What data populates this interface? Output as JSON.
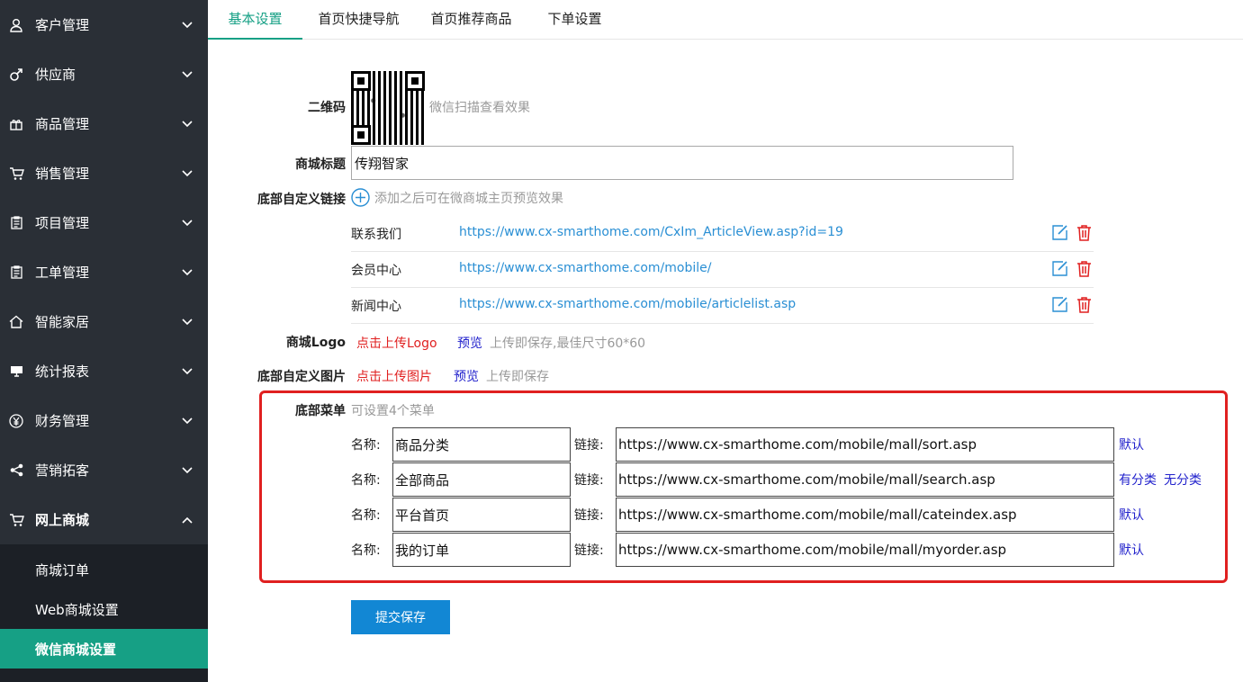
{
  "sidebar": {
    "items": [
      {
        "label": "客户管理",
        "icon": "user-icon"
      },
      {
        "label": "供应商",
        "icon": "male-icon"
      },
      {
        "label": "商品管理",
        "icon": "gift-icon"
      },
      {
        "label": "销售管理",
        "icon": "cart-icon"
      },
      {
        "label": "项目管理",
        "icon": "clipboard-icon"
      },
      {
        "label": "工单管理",
        "icon": "clipboard-icon"
      },
      {
        "label": "智能家居",
        "icon": "home-icon"
      },
      {
        "label": "统计报表",
        "icon": "monitor-icon"
      },
      {
        "label": "财务管理",
        "icon": "yen-icon"
      },
      {
        "label": "营销拓客",
        "icon": "share-icon"
      },
      {
        "label": "网上商城",
        "icon": "cart-icon"
      }
    ],
    "sub_items": [
      {
        "label": "商城订单"
      },
      {
        "label": "Web商城设置"
      },
      {
        "label": "微信商城设置"
      }
    ]
  },
  "tabs": [
    {
      "label": "基本设置"
    },
    {
      "label": "首页快捷导航"
    },
    {
      "label": "首页推荐商品"
    },
    {
      "label": "下单设置"
    }
  ],
  "form": {
    "qr_label": "二维码",
    "qr_hint": "微信扫描查看效果",
    "title_label": "商城标题",
    "title_value": "传翔智家",
    "footer_links_label": "底部自定义链接",
    "footer_links_hint": "添加之后可在微商城主页预览效果",
    "footer_links": [
      {
        "name": "联系我们",
        "url": "https://www.cx-smarthome.com/CxIm_ArticleView.asp?id=19"
      },
      {
        "name": "会员中心",
        "url": "https://www.cx-smarthome.com/mobile/"
      },
      {
        "name": "新闻中心",
        "url": "https://www.cx-smarthome.com/mobile/articlelist.asp"
      }
    ],
    "logo_label": "商城Logo",
    "logo_upload": "点击上传Logo",
    "logo_preview": "预览",
    "logo_hint": "上传即保存,最佳尺寸60*60",
    "image_label": "底部自定义图片",
    "image_upload": "点击上传图片",
    "image_preview": "预览",
    "image_hint": "上传即保存",
    "menu_label": "底部菜单",
    "menu_hint": "可设置4个菜单",
    "menu_name_label": "名称:",
    "menu_link_label": "链接:",
    "menus": [
      {
        "name": "商品分类",
        "url": "https://www.cx-smarthome.com/mobile/mall/sort.asp",
        "action1": "默认",
        "action2": ""
      },
      {
        "name": "全部商品",
        "url": "https://www.cx-smarthome.com/mobile/mall/search.asp",
        "action1": "有分类",
        "action2": "无分类"
      },
      {
        "name": "平台首页",
        "url": "https://www.cx-smarthome.com/mobile/mall/cateindex.asp",
        "action1": "默认",
        "action2": ""
      },
      {
        "name": "我的订单",
        "url": "https://www.cx-smarthome.com/mobile/mall/myorder.asp",
        "action1": "默认",
        "action2": ""
      }
    ],
    "submit_label": "提交保存"
  },
  "colors": {
    "sidebar_bg": "#2a2f36",
    "active_teal": "#16a085",
    "link_blue": "#2a8fd4",
    "danger_red": "#e02020",
    "submit_blue": "#1287d4"
  }
}
